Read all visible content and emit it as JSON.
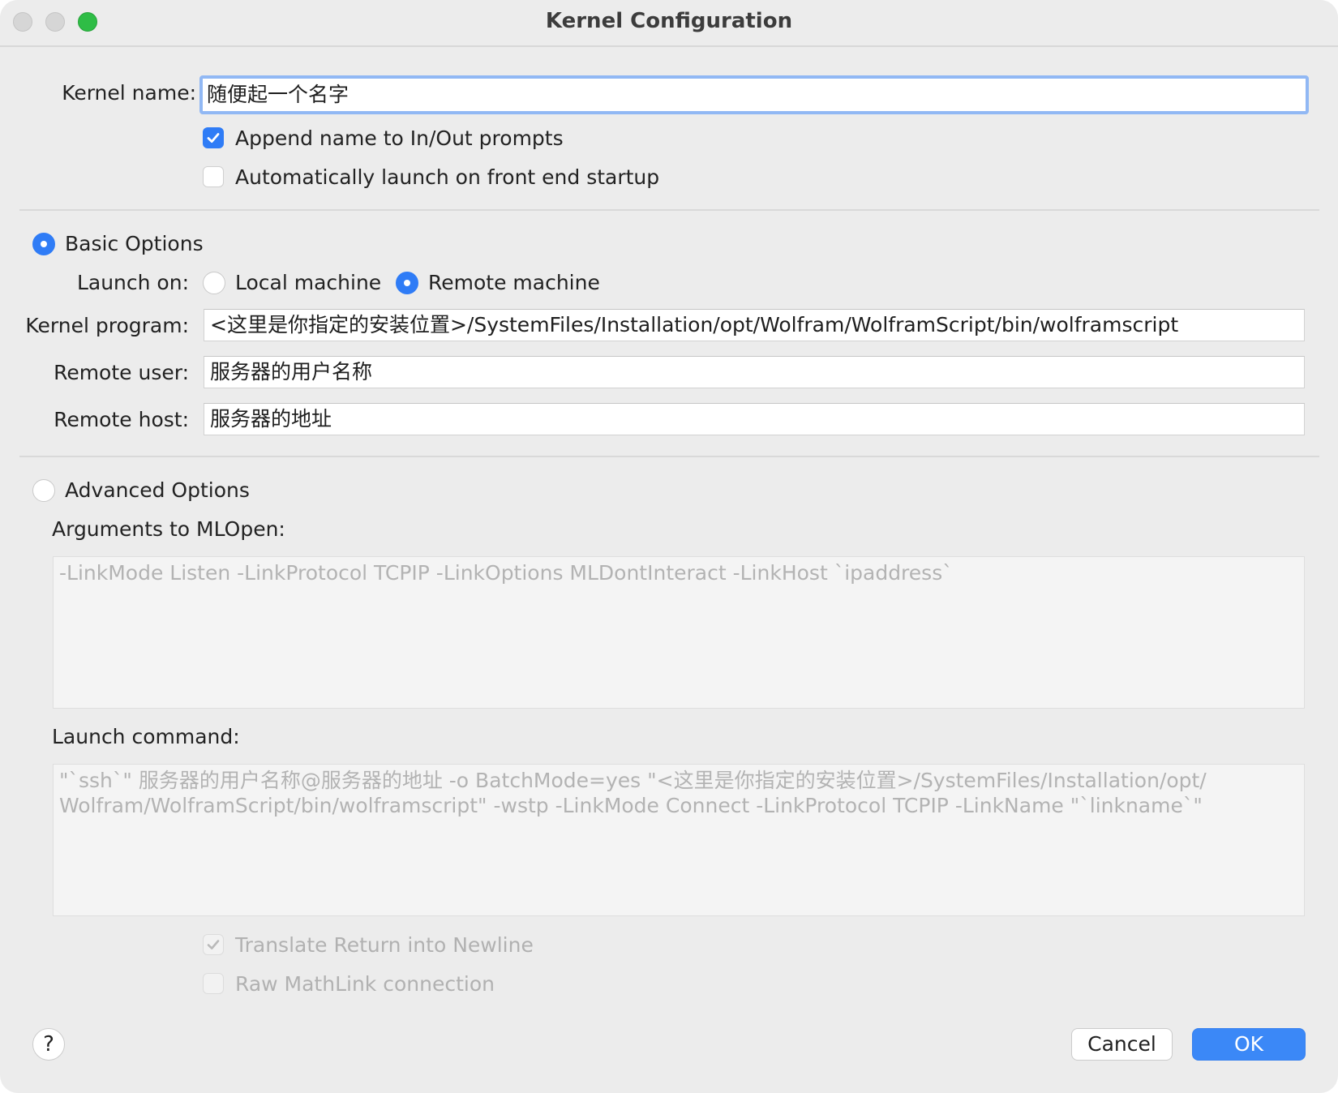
{
  "window": {
    "title": "Kernel Configuration"
  },
  "kernel_name": {
    "label": "Kernel name:",
    "value": "随便起一个名字"
  },
  "options": {
    "append_name": {
      "label": "Append name to In/Out prompts",
      "checked": true
    },
    "auto_launch": {
      "label": "Automatically launch on front end startup",
      "checked": false
    }
  },
  "basic": {
    "label": "Basic Options",
    "selected": true,
    "launch_on_label": "Launch on:",
    "local_label": "Local machine",
    "remote_label": "Remote machine",
    "launch_on_selected": "Remote machine",
    "kernel_program_label": "Kernel program:",
    "kernel_program_value": "<这里是你指定的安装位置>/SystemFiles/Installation/opt/Wolfram/WolframScript/bin/wolframscript",
    "remote_user_label": "Remote user:",
    "remote_user_value": "服务器的用户名称",
    "remote_host_label": "Remote host:",
    "remote_host_value": "服务器的地址"
  },
  "advanced": {
    "label": "Advanced Options",
    "selected": false,
    "mlopen_label": "Arguments to MLOpen:",
    "mlopen_value": "-LinkMode Listen -LinkProtocol TCPIP -LinkOptions MLDontInteract -LinkHost `ipaddress`",
    "launch_command_label": "Launch command:",
    "launch_command_line1": "\"`ssh`\" 服务器的用户名称@服务器的地址 -o BatchMode=yes \"<这里是你指定的安装位置>/SystemFiles/Installation/opt/",
    "launch_command_line2": "Wolfram/WolframScript/bin/wolframscript\" -wstp -LinkMode Connect -LinkProtocol TCPIP -LinkName \"`linkname`\"",
    "translate_return": {
      "label": "Translate Return into Newline",
      "checked": true,
      "enabled": false
    },
    "raw_mathlink": {
      "label": "Raw MathLink connection",
      "checked": false,
      "enabled": false
    }
  },
  "buttons": {
    "help": "?",
    "cancel": "Cancel",
    "ok": "OK"
  },
  "colors": {
    "accent": "#2f7cf6",
    "ok_button": "#3b88f7",
    "window_bg": "#ececec",
    "focus_ring": "#91b8f4"
  }
}
